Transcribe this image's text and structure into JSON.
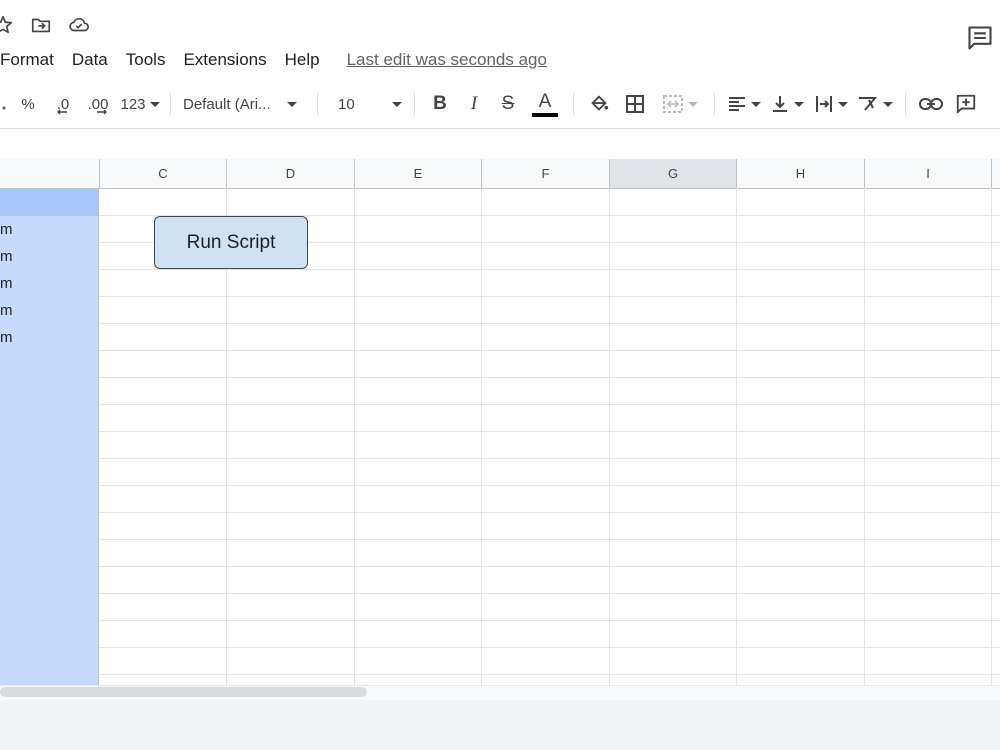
{
  "header": {
    "icons": [
      "star-icon",
      "move-to-folder-icon",
      "cloud-saved-icon"
    ],
    "menu": [
      "Format",
      "Data",
      "Tools",
      "Extensions",
      "Help"
    ],
    "last_edit": "Last edit was seconds ago"
  },
  "toolbar": {
    "percent": "%",
    "decrease_decimal": ".0",
    "increase_decimal": ".00",
    "number_format": "123",
    "font": "Default (Ari...",
    "font_size": "10",
    "bold": "B",
    "italic": "I",
    "strikethrough": "S",
    "text_color": "A"
  },
  "grid": {
    "columns": [
      "C",
      "D",
      "E",
      "F",
      "G",
      "H",
      "I"
    ],
    "selected_column": "G",
    "column_b_values": [
      "",
      "m",
      "m",
      "m",
      "m",
      "m",
      "",
      "",
      "",
      "",
      "",
      "",
      "",
      "",
      "",
      "",
      "",
      "",
      ""
    ]
  },
  "drawing": {
    "button_label": "Run Script"
  }
}
